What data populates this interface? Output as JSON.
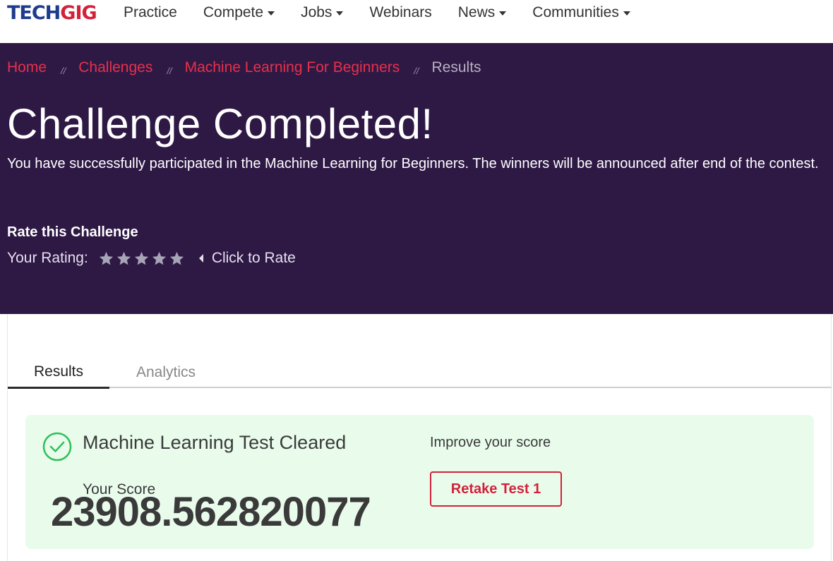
{
  "header": {
    "logo": {
      "part1": "TECH",
      "part2": "GIG"
    },
    "nav": [
      {
        "label": "Practice",
        "dropdown": false
      },
      {
        "label": "Compete",
        "dropdown": true
      },
      {
        "label": "Jobs",
        "dropdown": true
      },
      {
        "label": "Webinars",
        "dropdown": false
      },
      {
        "label": "News",
        "dropdown": true
      },
      {
        "label": "Communities",
        "dropdown": true
      }
    ]
  },
  "breadcrumb": {
    "items": [
      "Home",
      "Challenges",
      "Machine Learning For Beginners"
    ],
    "separator": "//",
    "current": "Results"
  },
  "hero": {
    "title": "Challenge Completed!",
    "description": "You have successfully participated in the Machine Learning for Beginners. The winners will be announced after end of the contest.",
    "rate_title": "Rate this Challenge",
    "rating_label": "Your Rating:",
    "stars": 5,
    "click_to_rate": "Click to Rate"
  },
  "tabs": [
    {
      "label": "Results",
      "active": true
    },
    {
      "label": "Analytics",
      "active": false
    }
  ],
  "result": {
    "title": "Machine Learning Test Cleared",
    "score_label": "Your Score",
    "score_value": "23908.562820077",
    "improve_label": "Improve your score",
    "retake_label": "Retake Test 1"
  },
  "colors": {
    "brand_blue": "#1e3c8c",
    "brand_red": "#d3213a",
    "hero_bg": "#2e1945",
    "success_bg": "#e9fcec",
    "success_green": "#2fbf5a"
  }
}
